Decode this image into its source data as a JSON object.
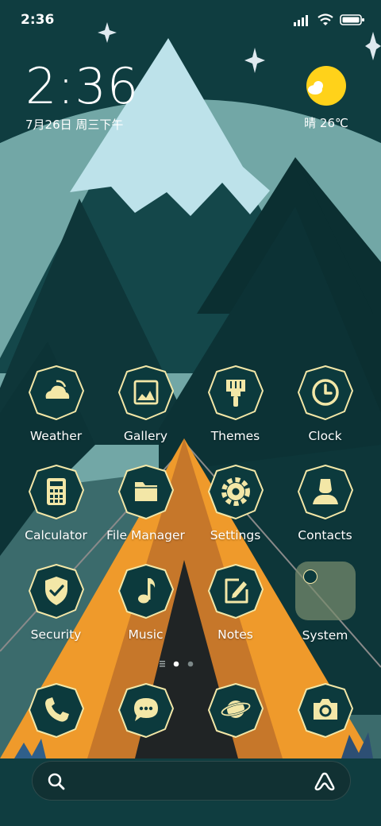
{
  "status_bar": {
    "time": "2:36"
  },
  "clock_widget": {
    "time": "2:36",
    "date": "7月26日 周三下午"
  },
  "weather_widget": {
    "text": "晴 26℃"
  },
  "apps": [
    {
      "label": "Weather",
      "icon": "weather-icon"
    },
    {
      "label": "Gallery",
      "icon": "gallery-icon"
    },
    {
      "label": "Themes",
      "icon": "themes-brush-icon"
    },
    {
      "label": "Clock",
      "icon": "clock-icon"
    },
    {
      "label": "Calculator",
      "icon": "calculator-icon"
    },
    {
      "label": "File Manager",
      "icon": "folder-icon"
    },
    {
      "label": "Settings",
      "icon": "gear-icon"
    },
    {
      "label": "Contacts",
      "icon": "contact-icon"
    },
    {
      "label": "Security",
      "icon": "shield-check-icon"
    },
    {
      "label": "Music",
      "icon": "music-note-icon"
    },
    {
      "label": "Notes",
      "icon": "notes-edit-icon"
    },
    {
      "label": "System",
      "icon": "folder-icon"
    }
  ],
  "dock": [
    {
      "icon": "phone-icon"
    },
    {
      "icon": "message-icon"
    },
    {
      "icon": "browser-planet-icon"
    },
    {
      "icon": "camera-icon"
    }
  ],
  "page_indicator": {
    "pages": 2,
    "current": 1
  },
  "colors": {
    "icon_fill": "#0c3a3d",
    "icon_stroke": "#f3e7a7",
    "tent": "#ef9a2b",
    "sun": "#ffd21a"
  }
}
